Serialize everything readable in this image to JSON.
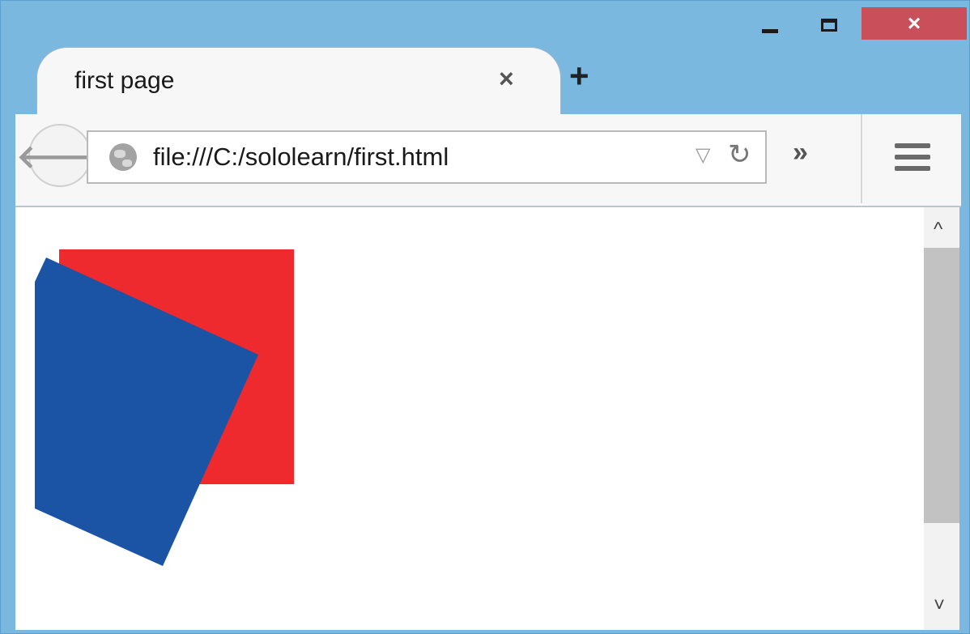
{
  "window": {
    "minimize_icon": "minimize-icon",
    "maximize_icon": "maximize-icon",
    "close_label": "×"
  },
  "tab": {
    "title": "first page",
    "close_label": "×"
  },
  "new_tab_label": "+",
  "toolbar": {
    "back_label": "🡐",
    "url": "file:///C:/sololearn/first.html",
    "dropdown_label": "▽",
    "reload_label": "↻",
    "overflow_label": "»"
  },
  "content": {
    "shapes": [
      {
        "name": "red-square",
        "color": "#ee2a2e"
      },
      {
        "name": "blue-rotated-square",
        "color": "#1c54a5"
      }
    ]
  },
  "scrollbar": {
    "up_label": "^",
    "down_label": "˅"
  }
}
